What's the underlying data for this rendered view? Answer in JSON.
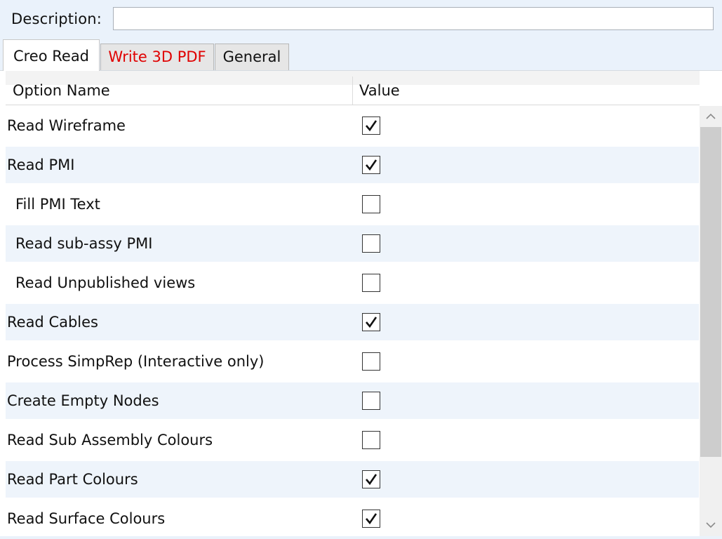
{
  "description": {
    "label": "Description:",
    "value": ""
  },
  "tabs": [
    {
      "label": "Creo Read",
      "active": true
    },
    {
      "label": "Write 3D PDF",
      "active": false,
      "color": "#e00000"
    },
    {
      "label": "General",
      "active": false
    }
  ],
  "grid": {
    "columns": {
      "name": "Option Name",
      "value": "Value"
    },
    "rows": [
      {
        "label": "Read Wireframe",
        "checked": true,
        "indent": 0
      },
      {
        "label": "Read PMI",
        "checked": true,
        "indent": 0
      },
      {
        "label": "Fill PMI Text",
        "checked": false,
        "indent": 1
      },
      {
        "label": "Read sub-assy PMI",
        "checked": false,
        "indent": 1
      },
      {
        "label": "Read Unpublished views",
        "checked": false,
        "indent": 1
      },
      {
        "label": "Read Cables",
        "checked": true,
        "indent": 0
      },
      {
        "label": "Process SimpRep (Interactive only)",
        "checked": false,
        "indent": 0
      },
      {
        "label": "Create Empty Nodes",
        "checked": false,
        "indent": 0
      },
      {
        "label": "Read Sub Assembly Colours",
        "checked": false,
        "indent": 0
      },
      {
        "label": "Read Part Colours",
        "checked": true,
        "indent": 0
      },
      {
        "label": "Read Surface Colours",
        "checked": true,
        "indent": 0
      }
    ]
  },
  "colors": {
    "accent_red": "#e00000",
    "row_alt": "#eef4fb",
    "background": "#eaf2fb"
  }
}
